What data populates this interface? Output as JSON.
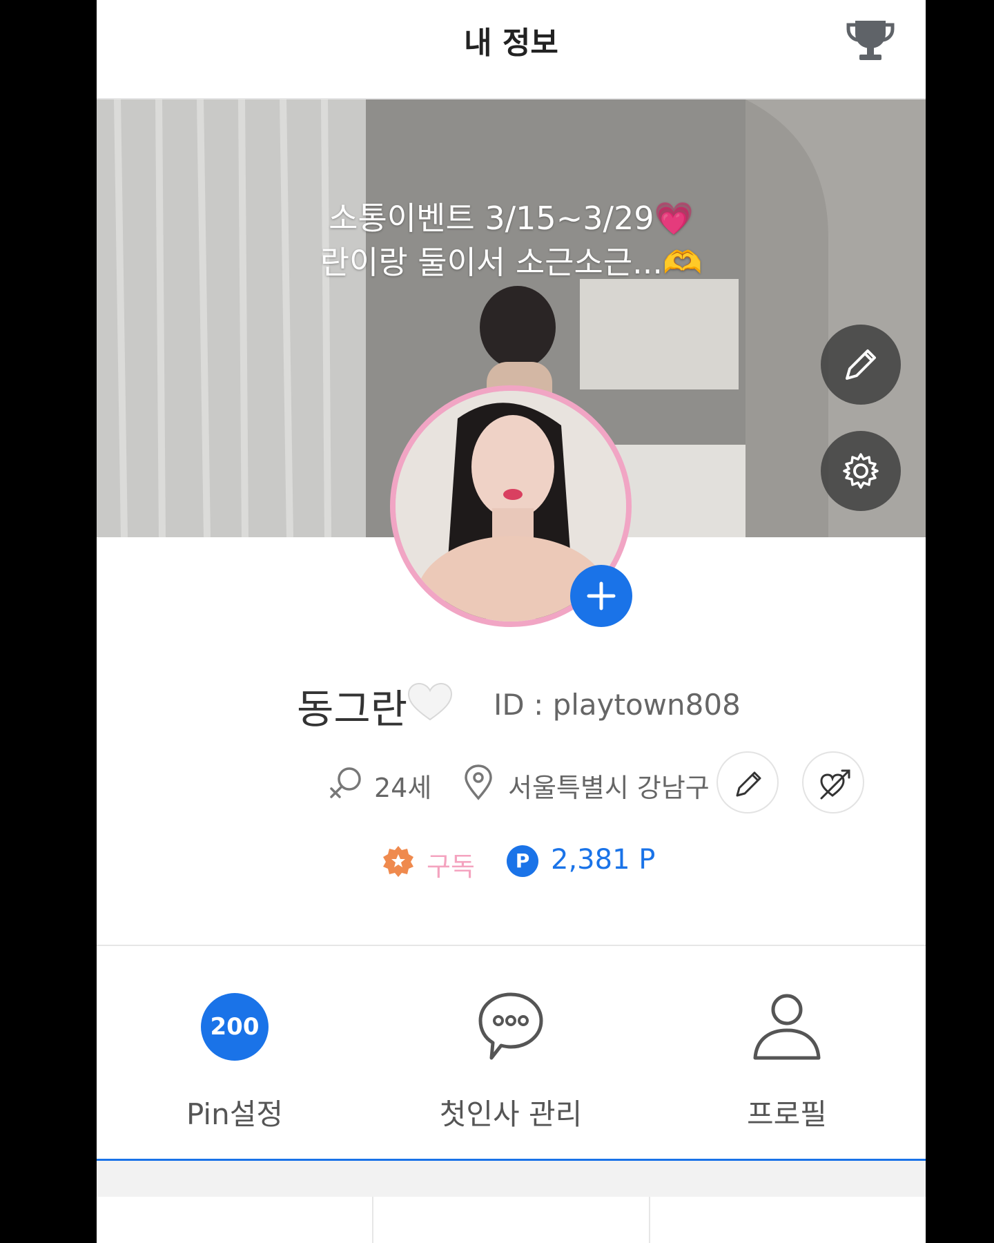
{
  "header": {
    "title": "내 정보",
    "trophy_icon": "trophy-icon"
  },
  "cover": {
    "caption_line1": "소통이벤트 3/15~3/29💗",
    "caption_line2": "란이랑 둘이서 소근소근...🫶",
    "edit_icon": "pencil-icon",
    "settings_icon": "gear-icon"
  },
  "profile": {
    "nickname": "동그란",
    "nickname_emoji": "white-heart",
    "id_text": "ID : playtown808",
    "age": "24세",
    "location": "서울특별시 강남구",
    "subscription_label": "구독",
    "points": "2,381 P",
    "points_badge": "P"
  },
  "menu": [
    {
      "label": "Pin설정",
      "count": "200"
    },
    {
      "label": "첫인사 관리",
      "icon": "chat-bubble-icon"
    },
    {
      "label": "프로필",
      "icon": "person-icon"
    }
  ],
  "colors": {
    "accent": "#1a73e8",
    "avatar_ring": "#f1a5c4",
    "subscription": "#f4a3bf",
    "badge_orange": "#ef8a4e"
  }
}
